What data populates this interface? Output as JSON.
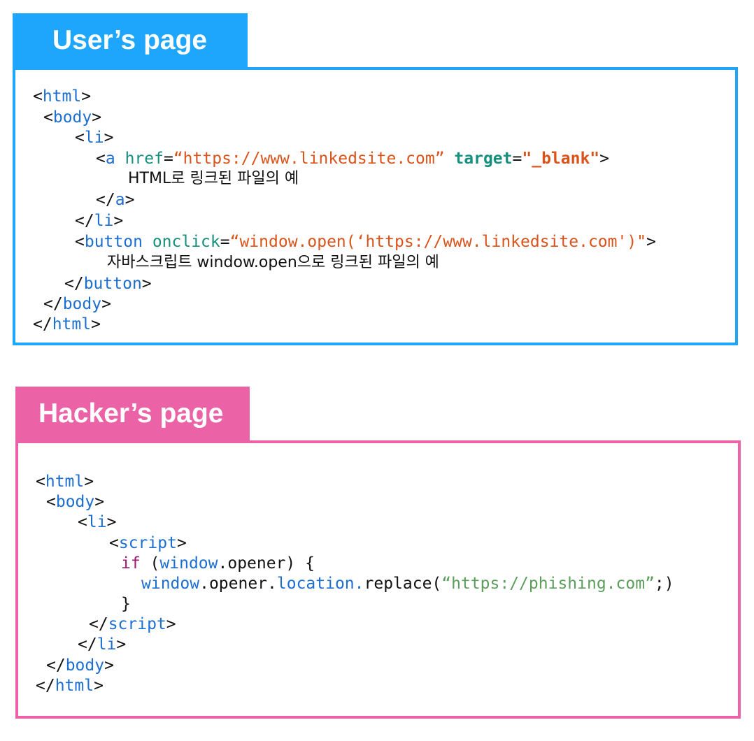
{
  "user_panel": {
    "title": "User’s page",
    "code": {
      "l1_open": "<",
      "l1_tag": "html",
      "l1_close": ">",
      "l2_open": "<",
      "l2_tag": "body",
      "l2_close": ">",
      "l3_open": "<",
      "l3_tag": "li",
      "l3_close": ">",
      "l4_open": "<",
      "l4_tag": "a",
      "l4_sp1": " ",
      "l4_attr1": "href",
      "l4_eq1": "=",
      "l4_val1": "“https://www.linkedsite.com”",
      "l4_sp2": " ",
      "l4_attr2": "target",
      "l4_eq2": "=",
      "l4_val2": "\"_blank\"",
      "l4_close": ">",
      "l5_text": "HTML로 링크된 파일의 예",
      "l6_open": "</",
      "l6_tag": "a",
      "l6_close": ">",
      "l7_open": "</",
      "l7_tag": "li",
      "l7_close": ">",
      "l8_open": "<",
      "l8_tag": "button",
      "l8_sp1": " ",
      "l8_attr": "onclick",
      "l8_eq": "=",
      "l8_val": "“window.open(‘https://www.linkedsite.com')\"",
      "l8_close": ">",
      "l9_text": "자바스크립트 window.open으로 링크된 파일의 예",
      "l10_open": "</",
      "l10_tag": "button",
      "l10_close": ">",
      "l11_open": "</",
      "l11_tag": "body",
      "l11_close": ">",
      "l12_open": "</",
      "l12_tag": "html",
      "l12_close": ">"
    }
  },
  "hacker_panel": {
    "title": "Hacker’s page",
    "code": {
      "l1_open": "<",
      "l1_tag": "html",
      "l1_close": ">",
      "l2_open": "<",
      "l2_tag": "body",
      "l2_close": ">",
      "l3_open": "<",
      "l3_tag": "li",
      "l3_close": ">",
      "l4_open": "<",
      "l4_tag": "script",
      "l4_close": ">",
      "l5_kw": "if",
      "l5_paren_open": " (",
      "l5_obj": "window",
      "l5_rest": ".opener) {",
      "l6_obj": "window",
      "l6_mid": ".opener.",
      "l6_prop": "location.",
      "l6_fn": "replace(",
      "l6_str": "“https://phishing.com”",
      "l6_end": ";)",
      "l7_brace": "}",
      "l8_open": "</",
      "l8_tag": "script",
      "l8_close": ">",
      "l9_open": "</",
      "l9_tag": "li",
      "l9_close": ">",
      "l10_open": "</",
      "l10_tag": "body",
      "l10_close": ">",
      "l11_open": "</",
      "l11_tag": "html",
      "l11_close": ">"
    }
  },
  "colors": {
    "user_accent": "#1ea5fc",
    "hacker_accent": "#eb62a6",
    "tag": "#1c6fd1",
    "attribute": "#168f7c",
    "string": "#d9531b",
    "keyword": "#9b1b6b",
    "js_string": "#5b9e5a",
    "text": "#111111"
  }
}
